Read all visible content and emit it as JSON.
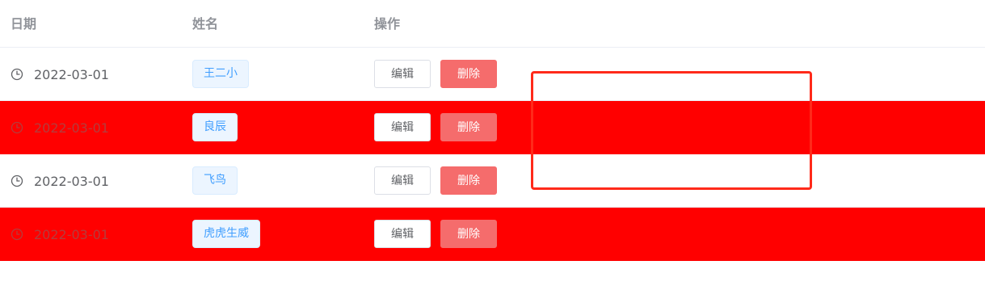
{
  "table": {
    "columns": [
      "日期",
      "姓名",
      "操作"
    ],
    "rows": [
      {
        "date": "2022-03-01",
        "name": "王二小",
        "edit_label": "编辑",
        "delete_label": "删除",
        "highlighted": false
      },
      {
        "date": "2022-03-01",
        "name": "良辰",
        "edit_label": "编辑",
        "delete_label": "删除",
        "highlighted": true
      },
      {
        "date": "2022-03-01",
        "name": "飞鸟",
        "edit_label": "编辑",
        "delete_label": "删除",
        "highlighted": false
      },
      {
        "date": "2022-03-01",
        "name": "虎虎生威",
        "edit_label": "编辑",
        "delete_label": "删除",
        "highlighted": true
      }
    ]
  },
  "colors": {
    "highlight_row": "#ff0000",
    "header_text": "#909399",
    "tag_bg": "#ecf5ff",
    "tag_text": "#409eff",
    "delete_button": "#f56c6c",
    "annotation_border": "#ff2a1a"
  },
  "icons": {
    "date": "clock-icon"
  }
}
